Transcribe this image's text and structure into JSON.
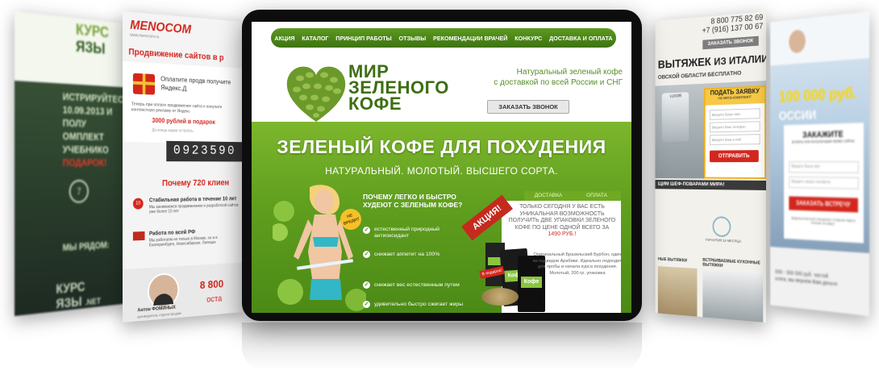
{
  "left_far_card": {
    "heading_line1": "КУРС",
    "heading_line2": "ЯЗЫ",
    "text_line1": "ИСТРИРУЙТЕСЬ",
    "text_line2": "10.09.2013 И ПОЛУ",
    "text_line3": "ОМПЛЕКТ УЧЕБНИКО",
    "text_line4": "ПОДАРОК!",
    "circle_number": "7",
    "cta": "МЫ РЯДОМ:",
    "footer_line1": "КУРС",
    "footer_line2": "ЯЗЫ",
    "footer_suffix": ".NET"
  },
  "left_card": {
    "logo": "MENOCOM",
    "logo_sub": "www.menocom.ru",
    "subtitle": "Продвижение сайтов в р",
    "offer_text": "Оплатите продв получите Яндекс.Д",
    "small_text": "Теперь при оплате продвижения сайта н получите контекстную рекламу от Яндекс",
    "price": "3000 рублей в подарок",
    "timer_label": "До конца акции осталось",
    "timer": "0923590",
    "why_title": "Почему 720 клиен",
    "point1_title": "Стабильная работа в течение 10 лет",
    "point1_text": "Мы занимаемся продвижением и разработкой сайтов уже более 10 лет",
    "point2_title": "Работа по всей РФ",
    "point2_text": "Мы работаем не только в Москве, но и в Екатеринбурге, Новосибирске, Липецке",
    "phone": "8 800",
    "person_name": "Антон ФОМИНЫХ",
    "person_role": "руководитель отдела продаж",
    "footer_text": "оста"
  },
  "tablet": {
    "nav": [
      "АКЦИЯ",
      "КАТАЛОГ",
      "ПРИНЦИП РАБОТЫ",
      "ОТЗЫВЫ",
      "РЕКОМЕНДАЦИИ ВРАЧЕЙ",
      "КОНКУРС",
      "ДОСТАВКА И ОПЛАТА"
    ],
    "logo_line1": "МИР",
    "logo_line2": "ЗЕЛЕНОГО",
    "logo_line3": "КОФЕ",
    "tagline_line1": "Натуральный зеленый кофе",
    "tagline_line2": "с доставкой по всей России и СНГ",
    "call_button": "ЗАКАЗАТЬ ЗВОНОК",
    "headline": "ЗЕЛЕНЫЙ КОФЕ ДЛЯ ПОХУДЕНИЯ",
    "subheadline": "НАТУРАЛЬНЫЙ. МОЛОТЫЙ. ВЫСШЕГО СОРТА.",
    "question_line1": "ПОЧЕМУ ЛЕГКО И БЫСТРО",
    "question_line2": "ХУДЕЮТ С ЗЕЛЕНЫМ КОФЕ?",
    "badge": "НЕ ВРЕДИТ",
    "benefits": [
      "естественный природный антиоксидант",
      "снижает аппетит на 100%",
      "снижает вес естественным путем",
      "удивительно быстро сжигает жиры"
    ],
    "offer_tabs": [
      "ДОСТАВКА",
      "ОПЛАТА"
    ],
    "promo_label": "АКЦИЯ!",
    "offer_text": "ТОЛЬКО СЕГОДНЯ У ВАС ЕСТЬ УНИКАЛЬНАЯ ВОЗМОЖНОСТЬ ПОЛУЧИТЬ ДВЕ УПАКОВКИ ЗЕЛЕНОГО КОФЕ ПО ЦЕНЕ ОДНОЙ",
    "offer_price_prefix": "ВСЕГО ЗА",
    "offer_price": "1490 РУБ.!",
    "pack_label": "Кофе",
    "product_desc": "Оригинальный Бразильский Бурбон, один из подвидов Арабики. Идеально подходит для пробы и начала курса похудения. Молотый, 200 гр. упаковка",
    "gift_label": "В подарок!"
  },
  "right_card": {
    "phone1": "8 800 775 82 69",
    "phone2": "+7 (916) 137 00 67",
    "order_button": "ЗАКАЗАТЬ ЗВОНОК",
    "headline_prefix": "ВЫТЯЖЕК",
    "headline_suffix": "ИЗ ИТАЛИИ",
    "subheadline": "ОВСКОЙ ОБЛАСТИ БЕСПЛАТНО",
    "form_title": "ПОДАТЬ ЗАЯВКУ",
    "form_sub": "на мега-комплект!",
    "form_fields": [
      "Введите Ваше имя",
      "Введите Ваш телефон",
      "Введите Ваш e-mail"
    ],
    "submit": "ОТПРАВИТЬ",
    "brand": "LUXOR",
    "chef_banner": "ЩИМ ШЕФ-ПОВАРАМИ МИРА!",
    "guarantee": "ГАРАНТИЯ 24 МЕСЯЦА",
    "section_left": "НЫЕ ВЫТЯЖКИ",
    "section_right": "ВСТРАИВАЕМЫЕ КУХОННЫЕ ВЫТЯЖКИ"
  },
  "right_far_card": {
    "amount": "100 000 руб.",
    "amount_sub": "ОССИИ",
    "form_title": "ЗАКАЖИТЕ",
    "form_sub": "встречу или консультацию прямо сейчас",
    "field1": "Введите Ваше имя",
    "field2": "Введите номер телефона",
    "button": "ЗАКАЗАТЬ ВСТРЕЧУ",
    "footnote": "Видеоконтактный специалист позвонит Вам в течение 15 минут",
    "bottom_text": "000 - 300 000 руб. чистой",
    "bottom_text2": "ьтата, мы вернем Вам деньги"
  }
}
